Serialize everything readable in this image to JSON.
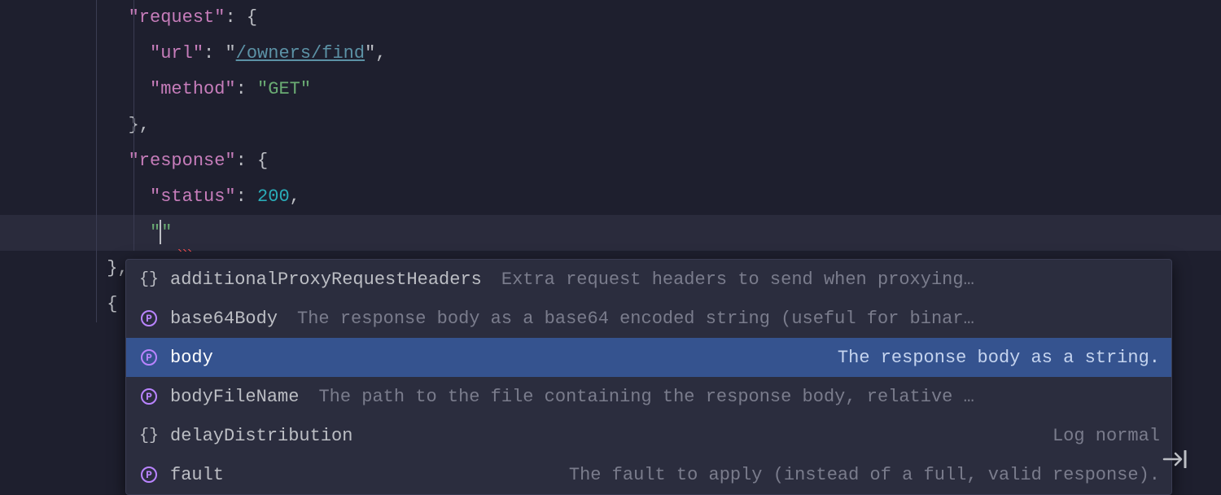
{
  "code_lines": {
    "l1_key": "\"request\"",
    "l2_key": "\"url\"",
    "l2_val": "/owners/find",
    "l3_key": "\"method\"",
    "l3_val": "\"GET\"",
    "l5_key": "\"response\"",
    "l6_key": "\"status\"",
    "l6_val": "200",
    "l7_empty_string": "\"\""
  },
  "punct": {
    "colon_brace": ": {",
    "colon_space": ": ",
    "comma": ",",
    "quote": "\"",
    "brace_close_comma": "},",
    "brace_close": "},",
    "brace_open": "{"
  },
  "suggestions": [
    {
      "icon": "braces",
      "label": "additionalProxyRequestHeaders",
      "desc": "Extra request headers to send when proxying…",
      "desc_align": "left",
      "selected": false
    },
    {
      "icon": "prop",
      "label": "base64Body",
      "desc": "The response body as a base64 encoded string (useful for binar…",
      "desc_align": "left",
      "selected": false
    },
    {
      "icon": "prop",
      "label": "body",
      "desc": "The response body as a string.",
      "desc_align": "right",
      "selected": true
    },
    {
      "icon": "prop",
      "label": "bodyFileName",
      "desc": "The path to the file containing the response body, relative …",
      "desc_align": "left",
      "selected": false
    },
    {
      "icon": "braces",
      "label": "delayDistribution",
      "desc": "Log normal",
      "desc_align": "right",
      "selected": false
    },
    {
      "icon": "prop",
      "label": "fault",
      "desc": "The fault to apply (instead of a full, valid response).",
      "desc_align": "right",
      "selected": false
    }
  ]
}
